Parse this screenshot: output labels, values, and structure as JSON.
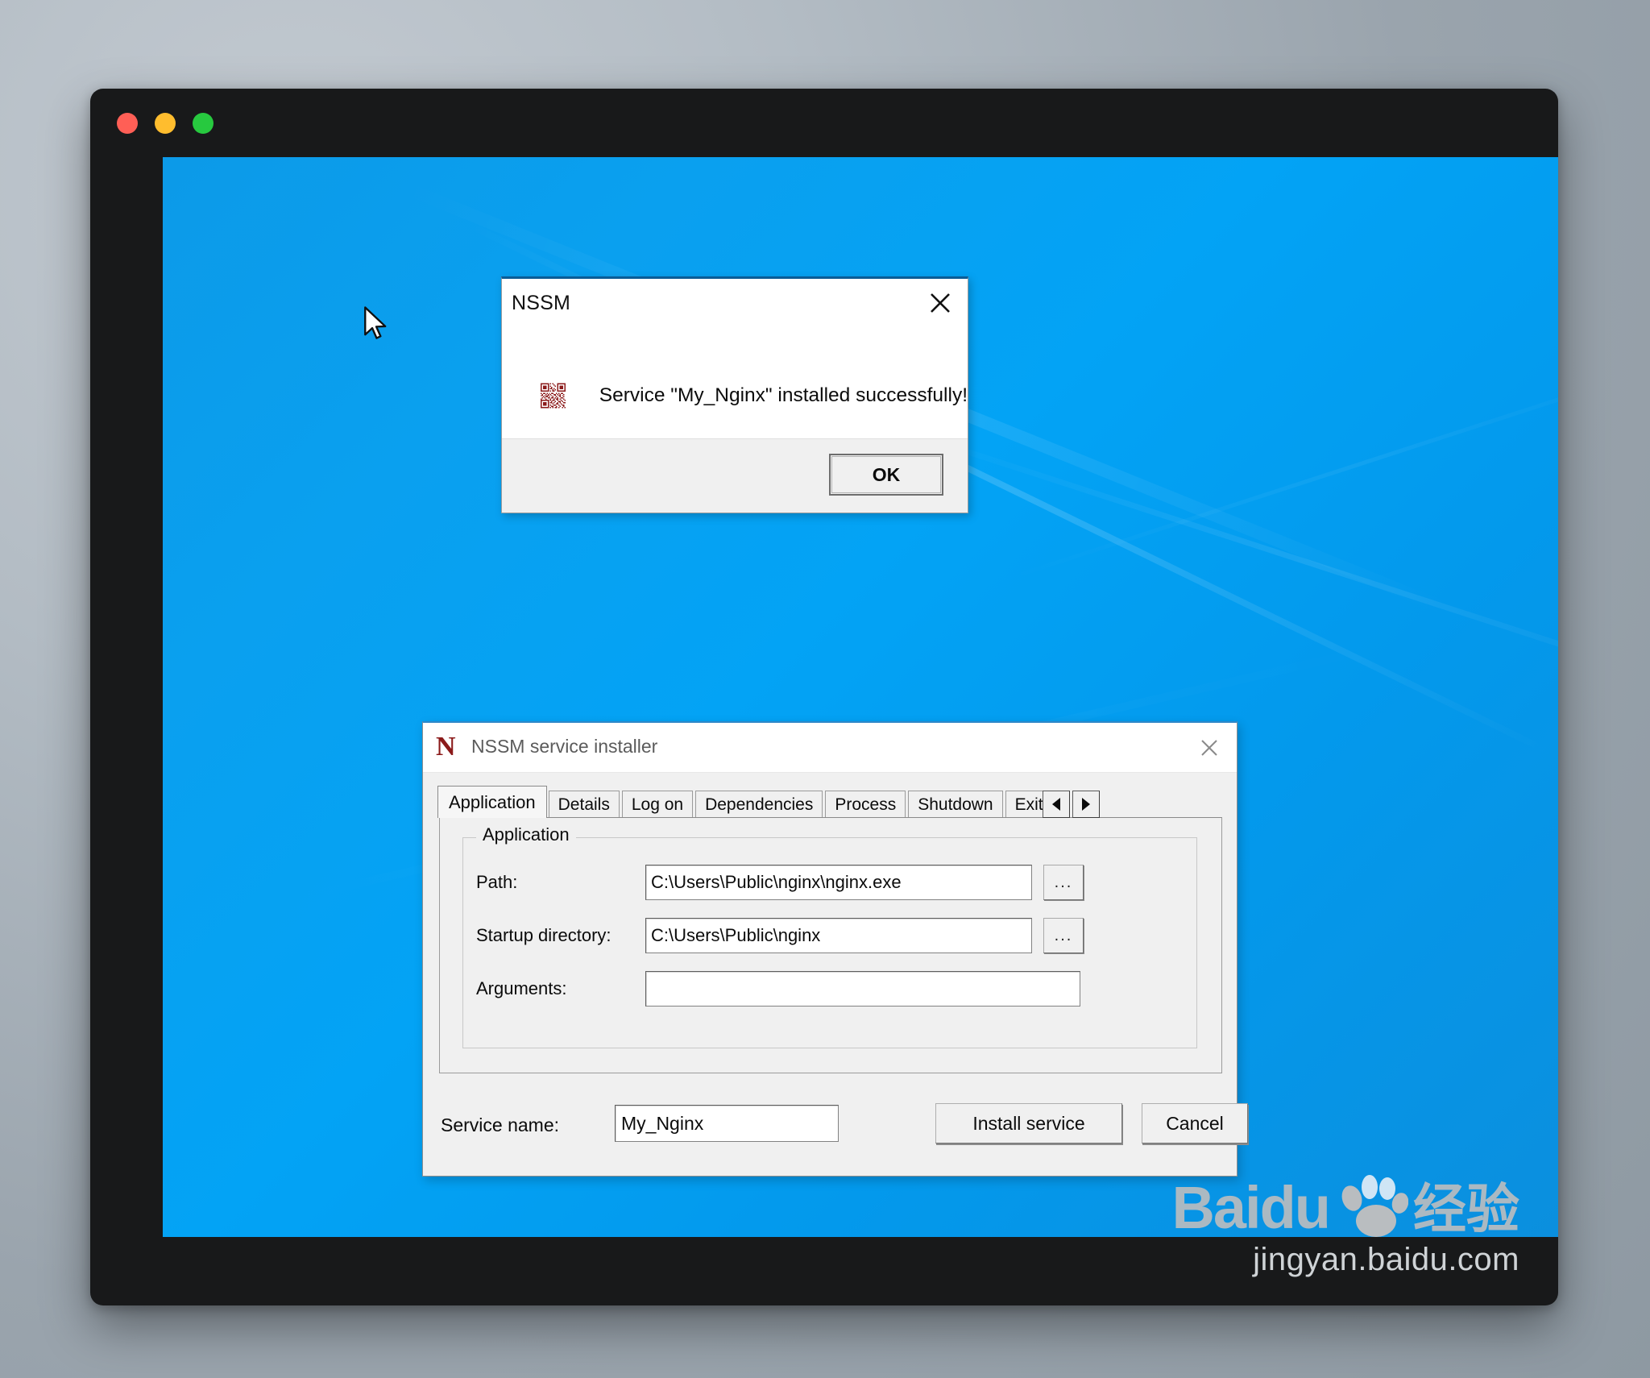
{
  "window_chrome": {
    "traffic_lights": [
      {
        "name": "close",
        "color": "#ff5f56"
      },
      {
        "name": "minimize",
        "color": "#ffbd2e"
      },
      {
        "name": "zoom",
        "color": "#27c93f"
      }
    ]
  },
  "message_box": {
    "title": "NSSM",
    "close_icon": "close-x-icon",
    "icon": "qr-code-icon",
    "message": "Service \"My_Nginx\" installed successfully!",
    "ok_label": "OK"
  },
  "installer": {
    "app_icon_letter": "N",
    "title": "NSSM service installer",
    "close_icon": "close-x-icon",
    "tabs": [
      {
        "label": "Application",
        "active": true
      },
      {
        "label": "Details",
        "active": false
      },
      {
        "label": "Log on",
        "active": false
      },
      {
        "label": "Dependencies",
        "active": false
      },
      {
        "label": "Process",
        "active": false
      },
      {
        "label": "Shutdown",
        "active": false
      },
      {
        "label": "Exit",
        "active": false,
        "clipped": true
      }
    ],
    "tab_scroll": {
      "left_icon": "triangle-left-icon",
      "right_icon": "triangle-right-icon"
    },
    "group": {
      "legend": "Application",
      "fields": [
        {
          "label": "Path:",
          "value": "C:\\Users\\Public\\nginx\\nginx.exe",
          "browse": "...",
          "placeholder": ""
        },
        {
          "label": "Startup directory:",
          "value": "C:\\Users\\Public\\nginx",
          "browse": "...",
          "placeholder": ""
        },
        {
          "label": "Arguments:",
          "value": "",
          "browse": "",
          "placeholder": ""
        }
      ]
    },
    "service_name_label": "Service name:",
    "service_name_value": "My_Nginx",
    "install_label": "Install service",
    "cancel_label": "Cancel"
  },
  "watermark": {
    "brand": "Bai",
    "brand_suffix": "du",
    "brand_cn": "经验",
    "url": "jingyan.baidu.com"
  },
  "colors": {
    "desktop_blue": "#03a3f5",
    "accent_title_blue": "#0a5c96",
    "nssm_red": "#8b1a1a",
    "dialog_face": "#f0f0f0"
  }
}
